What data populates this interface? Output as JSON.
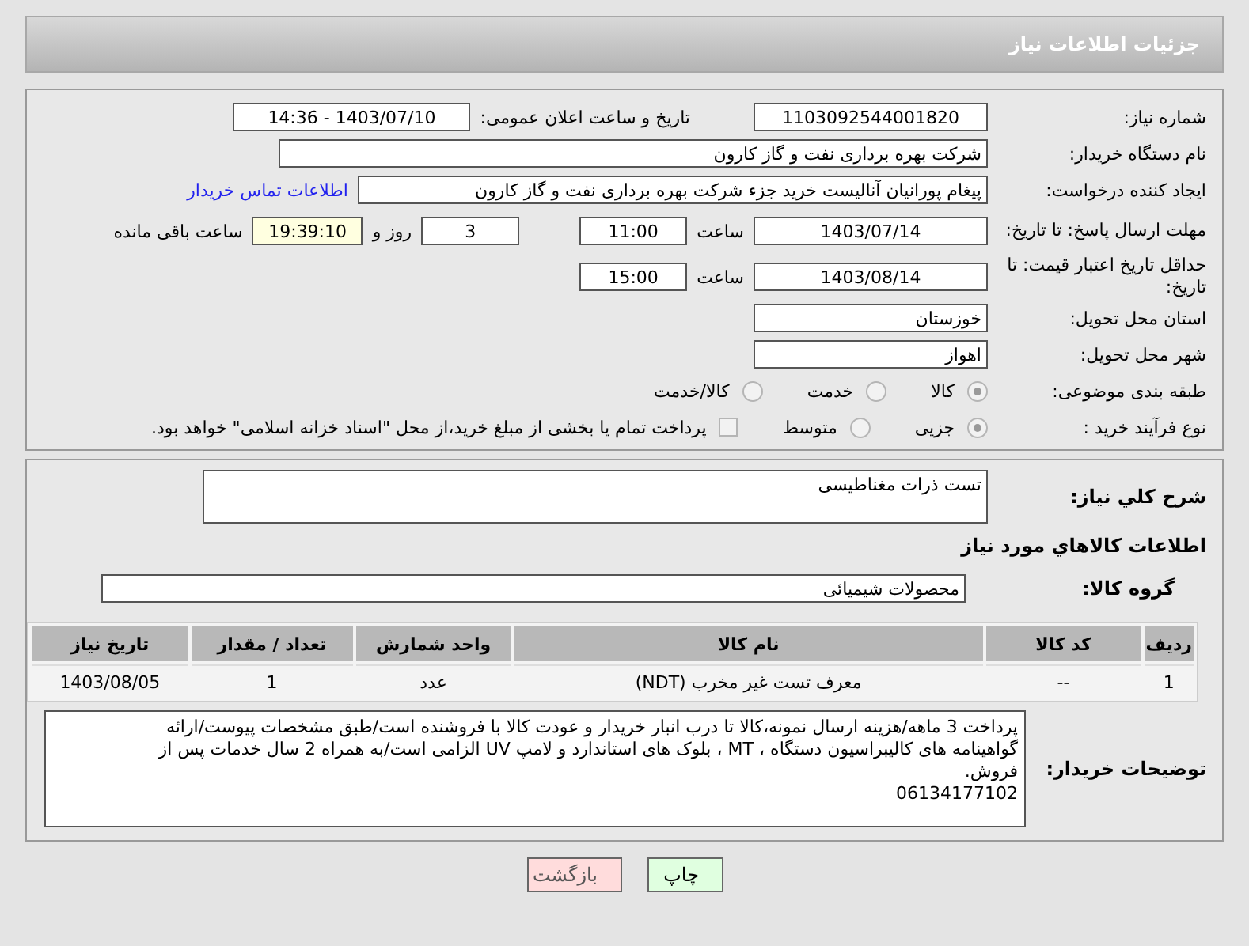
{
  "header": {
    "title": "جزئیات اطلاعات نیاز"
  },
  "need_number": {
    "label": "شماره نیاز:",
    "value": "1103092544001820"
  },
  "announce": {
    "label": "تاریخ و ساعت اعلان عمومی:",
    "value": "1403/07/10 - 14:36"
  },
  "buyer": {
    "label": "نام دستگاه خریدار:",
    "value": "شرکت بهره برداری نفت و گاز کارون"
  },
  "creator": {
    "label": "ایجاد کننده درخواست:",
    "value": "پیغام پورانیان آنالیست خرید جزء شرکت بهره برداری نفت و گاز کارون",
    "link": "اطلاعات تماس خریدار"
  },
  "reply_deadline": {
    "label": "مهلت ارسال پاسخ: تا تاریخ:",
    "date": "1403/07/14",
    "time_label": "ساعت",
    "time": "11:00",
    "days": "3",
    "days_label": "روز و",
    "remaining": "19:39:10",
    "remaining_label": "ساعت باقی مانده"
  },
  "price_validity": {
    "label": "حداقل تاریخ اعتبار قیمت: تا تاریخ:",
    "date": "1403/08/14",
    "time_label": "ساعت",
    "time": "15:00"
  },
  "province": {
    "label": "استان محل تحویل:",
    "value": "خوزستان"
  },
  "city": {
    "label": "شهر محل تحویل:",
    "value": "اهواز"
  },
  "category": {
    "label": "طبقه بندی موضوعی:",
    "options": [
      {
        "label": "کالا",
        "selected": true
      },
      {
        "label": "خدمت",
        "selected": false
      },
      {
        "label": "کالا/خدمت",
        "selected": false
      }
    ]
  },
  "process": {
    "label": "نوع فرآیند خرید :",
    "options": [
      {
        "label": "جزیی",
        "selected": true
      },
      {
        "label": "متوسط",
        "selected": false
      }
    ],
    "treasury": {
      "label": "پرداخت تمام یا بخشی از مبلغ خرید،از محل \"اسناد خزانه اسلامی\" خواهد بود.",
      "checked": false
    }
  },
  "summary": {
    "label": "شرح کلي نياز:",
    "value": "تست ذرات مغناطیسی"
  },
  "goods_heading": "اطلاعات کالاهاي مورد نياز",
  "goods_group": {
    "label": "گروه کالا:",
    "value": "محصولات شیمیائی"
  },
  "table": {
    "columns": [
      "ردیف",
      "کد کالا",
      "نام کالا",
      "واحد شمارش",
      "تعداد / مقدار",
      "تاریخ نیاز"
    ],
    "rows": [
      [
        "1",
        "--",
        "معرف تست غیر مخرب (NDT)",
        "عدد",
        "1",
        "1403/08/05"
      ]
    ]
  },
  "buyer_notes": {
    "label": "توضیحات خریدار:",
    "lines": [
      "پرداخت 3 ماهه/هزینه ارسال نمونه،کالا تا درب انبار خریدار و عودت کالا با فروشنده است/طبق مشخصات پیوست/ارائه",
      "گواهینامه های کالیبراسیون دستگاه ، MT ، بلوک های استاندارد و لامپ UV الزامی است/به همراه 2 سال خدمات پس از",
      "فروش.",
      "06134177102"
    ]
  },
  "buttons": [
    {
      "label": "چاپ",
      "kind": "print"
    },
    {
      "label": "بازگشت",
      "kind": "back"
    }
  ]
}
